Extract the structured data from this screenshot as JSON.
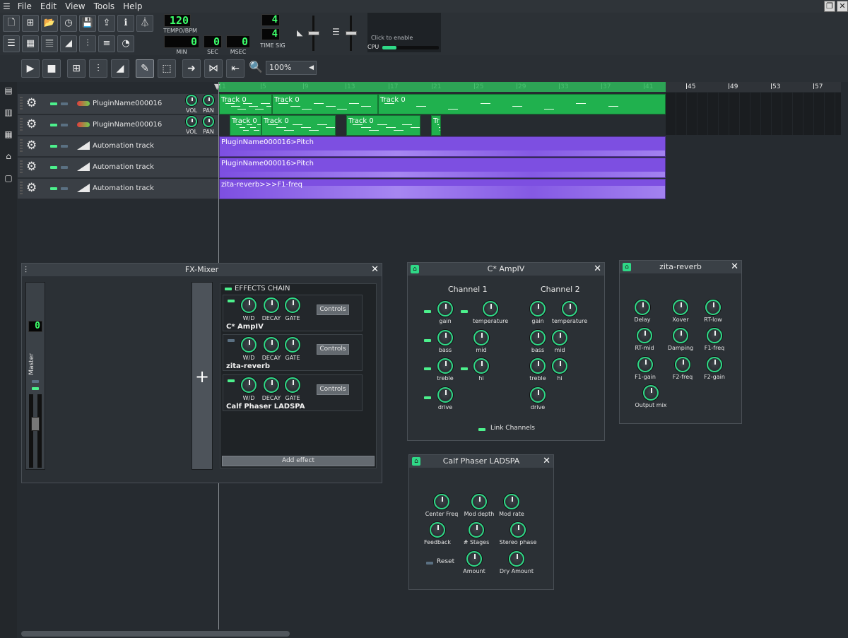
{
  "menu": [
    "File",
    "Edit",
    "View",
    "Tools",
    "Help"
  ],
  "toolbar": {
    "tempo_value": "120",
    "tempo_label": "TEMPO/BPM",
    "min_value": "0",
    "min_label": "MIN",
    "sec_value": "0",
    "sec_label": "SEC",
    "msec_value": "0",
    "msec_label": "MSEC",
    "timesig_num": "4",
    "timesig_den": "4",
    "timesig_label": "TIME SIG",
    "cpu_hint": "Click to enable",
    "cpu_label": "CPU"
  },
  "song_editor": {
    "zoom": "100%",
    "ruler_ticks": [
      "1",
      "5",
      "9",
      "13",
      "17",
      "21",
      "25",
      "29",
      "33",
      "37",
      "41",
      "45",
      "49",
      "53",
      "57"
    ],
    "tracks": [
      {
        "name": "PluginName000016",
        "type": "instrument",
        "vol": "VOL",
        "pan": "PAN",
        "segments": [
          {
            "label": "Track 0"
          },
          {
            "label": "Track 0"
          },
          {
            "label": "Track 0"
          }
        ]
      },
      {
        "name": "PluginName000016",
        "type": "instrument",
        "vol": "VOL",
        "pan": "PAN",
        "segments": [
          {
            "label": "Track 0"
          },
          {
            "label": "Track 0"
          },
          {
            "label": "Track 0"
          },
          {
            "label": "Tr"
          }
        ]
      },
      {
        "name": "Automation track",
        "type": "automation",
        "segments": [
          {
            "label": "PluginName000016>Pitch"
          }
        ]
      },
      {
        "name": "Automation track",
        "type": "automation",
        "segments": [
          {
            "label": "PluginName000016>Pitch"
          }
        ]
      },
      {
        "name": "Automation track",
        "type": "automation",
        "segments": [
          {
            "label": "zita-reverb>>>F1-freq"
          }
        ]
      }
    ]
  },
  "fx_mixer": {
    "title": "FX-Mixer",
    "channel_number": "0",
    "channel_name": "Master",
    "effects_chain_label": "EFFECTS CHAIN",
    "add_effect": "Add effect",
    "effects": [
      {
        "name": "C* AmpIV",
        "knobs": [
          "W/D",
          "DECAY",
          "GATE"
        ],
        "controls": "Controls"
      },
      {
        "name": "zita-reverb",
        "knobs": [
          "W/D",
          "DECAY",
          "GATE"
        ],
        "controls": "Controls"
      },
      {
        "name": "Calf Phaser LADSPA",
        "knobs": [
          "W/D",
          "DECAY",
          "GATE"
        ],
        "controls": "Controls"
      }
    ]
  },
  "ampiv": {
    "title": "C* AmpIV",
    "channel1": "Channel 1",
    "channel2": "Channel 2",
    "left_knobs": [
      "gain",
      "temperature",
      "bass",
      "mid",
      "treble",
      "hi",
      "drive"
    ],
    "right_knobs": [
      "gain",
      "temperature",
      "bass",
      "mid",
      "treble",
      "hi",
      "drive"
    ],
    "link_channels": "Link Channels"
  },
  "zita": {
    "title": "zita-reverb",
    "knobs": [
      "Delay",
      "Xover",
      "RT-low",
      "RT-mid",
      "Damping",
      "F1-freq",
      "F1-gain",
      "F2-freq",
      "F2-gain",
      "Output mix"
    ]
  },
  "phaser": {
    "title": "Calf Phaser LADSPA",
    "knobs": [
      "Center Freq",
      "Mod depth",
      "Mod rate",
      "Feedback",
      "# Stages",
      "Stereo phase",
      "Amount",
      "Dry Amount"
    ],
    "reset": "Reset"
  }
}
